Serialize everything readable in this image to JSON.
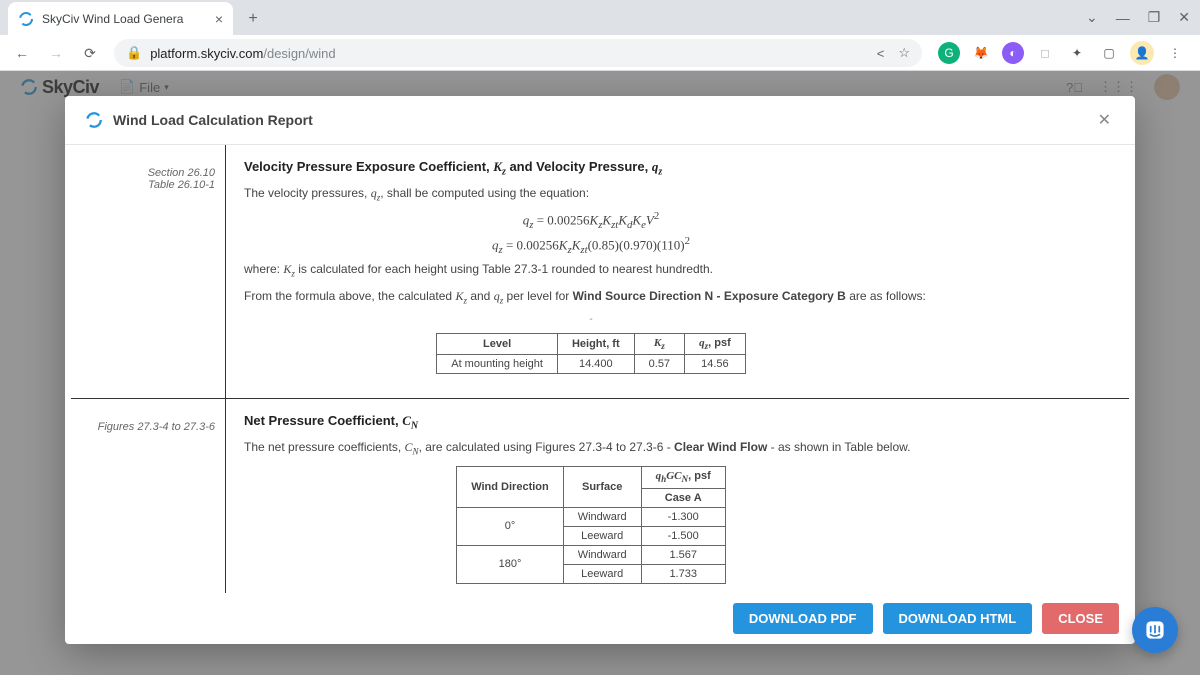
{
  "browser": {
    "tab_title": "SkyCiv Wind Load Genera",
    "url_host": "platform.skyciv.com",
    "url_path": "/design/wind"
  },
  "app": {
    "brand": "SkyCiv",
    "file_menu": "File"
  },
  "modal": {
    "title": "Wind Load Calculation Report",
    "buttons": {
      "download_pdf": "DOWNLOAD PDF",
      "download_html": "DOWNLOAD HTML",
      "close": "CLOSE"
    }
  },
  "section1": {
    "ref_line1": "Section 26.10",
    "ref_line2": "Table 26.10-1",
    "heading_prefix": "Velocity Pressure Exposure Coefficient, ",
    "heading_mid": " and Velocity Pressure, ",
    "intro_a": "The velocity pressures, ",
    "intro_b": ", shall be computed using the equation:",
    "where_a": "where: ",
    "where_b": " is calculated for each height using Table 27.3-1 rounded to nearest hundredth.",
    "from_a": "From the formula above, the calculated ",
    "from_mid": " and ",
    "from_b": " per level for ",
    "from_bold": "Wind Source Direction N - Exposure Category B",
    "from_tail": " are as follows:",
    "eq1": "q_z = 0.00256 K_z K_{zt} K_d K_e V^2",
    "eq2": "q_z = 0.00256 K_z K_{zt} (0.85)(0.970)(110)^2",
    "table": {
      "headers": [
        "Level",
        "Height, ft",
        "K_z",
        "q_z, psf"
      ],
      "rows": [
        [
          "At mounting height",
          "14.400",
          "0.57",
          "14.56"
        ]
      ]
    }
  },
  "section2": {
    "ref": "Figures 27.3-4 to 27.3-6",
    "heading_prefix": "Net Pressure Coefficient, ",
    "intro_a": "The net pressure coefficients, ",
    "intro_b": ", are calculated using Figures 27.3-4 to 27.3-6 - ",
    "intro_bold": "Clear Wind Flow",
    "intro_tail": " - as shown in Table below.",
    "table": {
      "headers": {
        "winddir": "Wind Direction",
        "surface": "Surface",
        "case_a": "Case A"
      },
      "rows": [
        {
          "dir": "0°",
          "surface": "Windward",
          "val": "-1.300"
        },
        {
          "dir": "0°",
          "surface": "Leeward",
          "val": "-1.500"
        },
        {
          "dir": "180°",
          "surface": "Windward",
          "val": "1.567"
        },
        {
          "dir": "180°",
          "surface": "Leeward",
          "val": "1.733"
        }
      ]
    }
  }
}
